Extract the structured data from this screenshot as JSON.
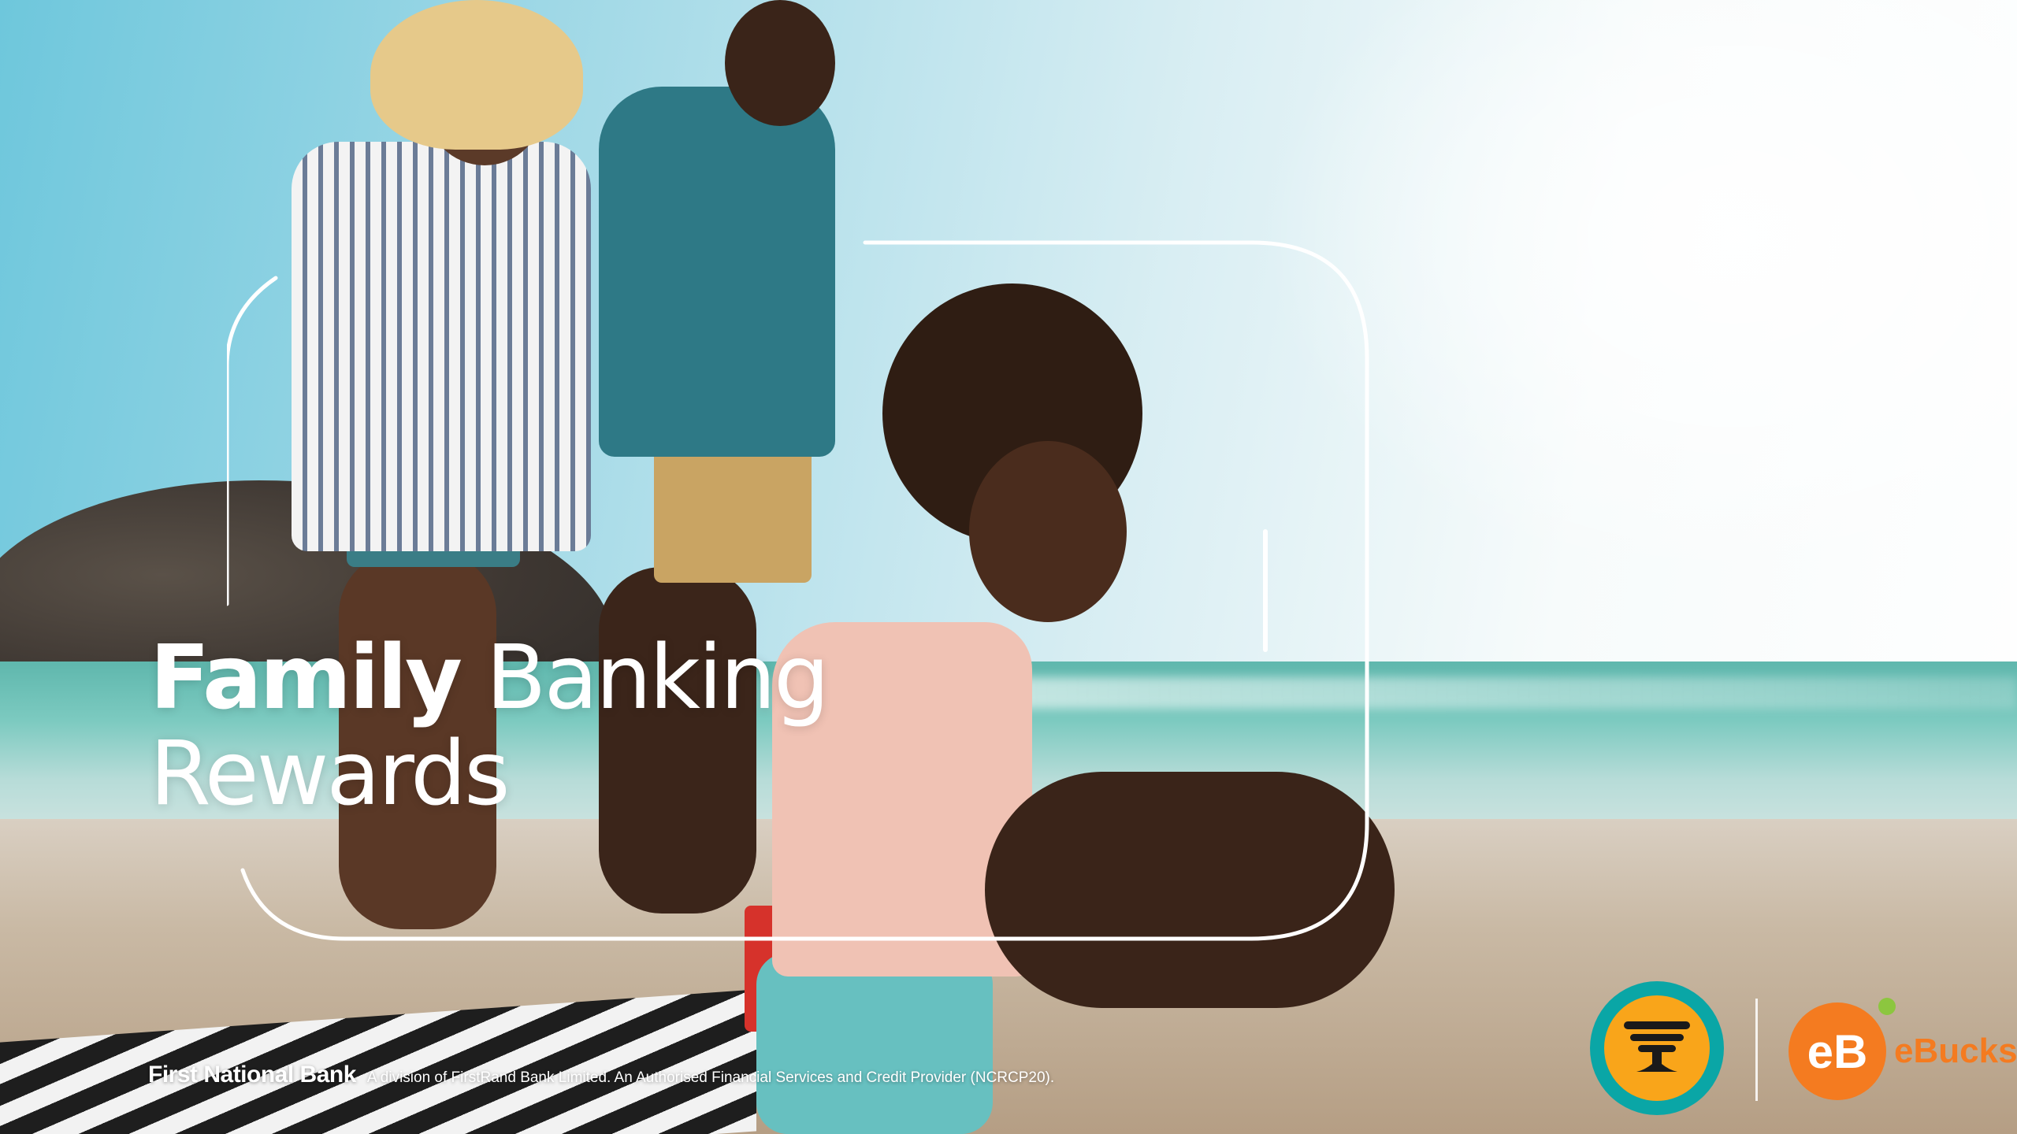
{
  "slide": {
    "title_bold": "Family",
    "title_regular_line1": "Banking",
    "title_regular_line2": "Rewards"
  },
  "footer": {
    "brand": "First National Bank",
    "disclaimer": "A division of FirstRand Bank Limited. An Authorised Financial Services and Credit Provider (NCRCP20)."
  },
  "logos": {
    "fnb_icon": "fnb-tree-logo",
    "ebucks_mark": "eB",
    "ebucks_text": "eBucks"
  },
  "colors": {
    "fnb_teal": "#0aa6a6",
    "fnb_orange": "#f9a51a",
    "ebucks_orange": "#f47b20",
    "ebucks_green": "#8cc63f",
    "title_text": "#ffffff"
  }
}
